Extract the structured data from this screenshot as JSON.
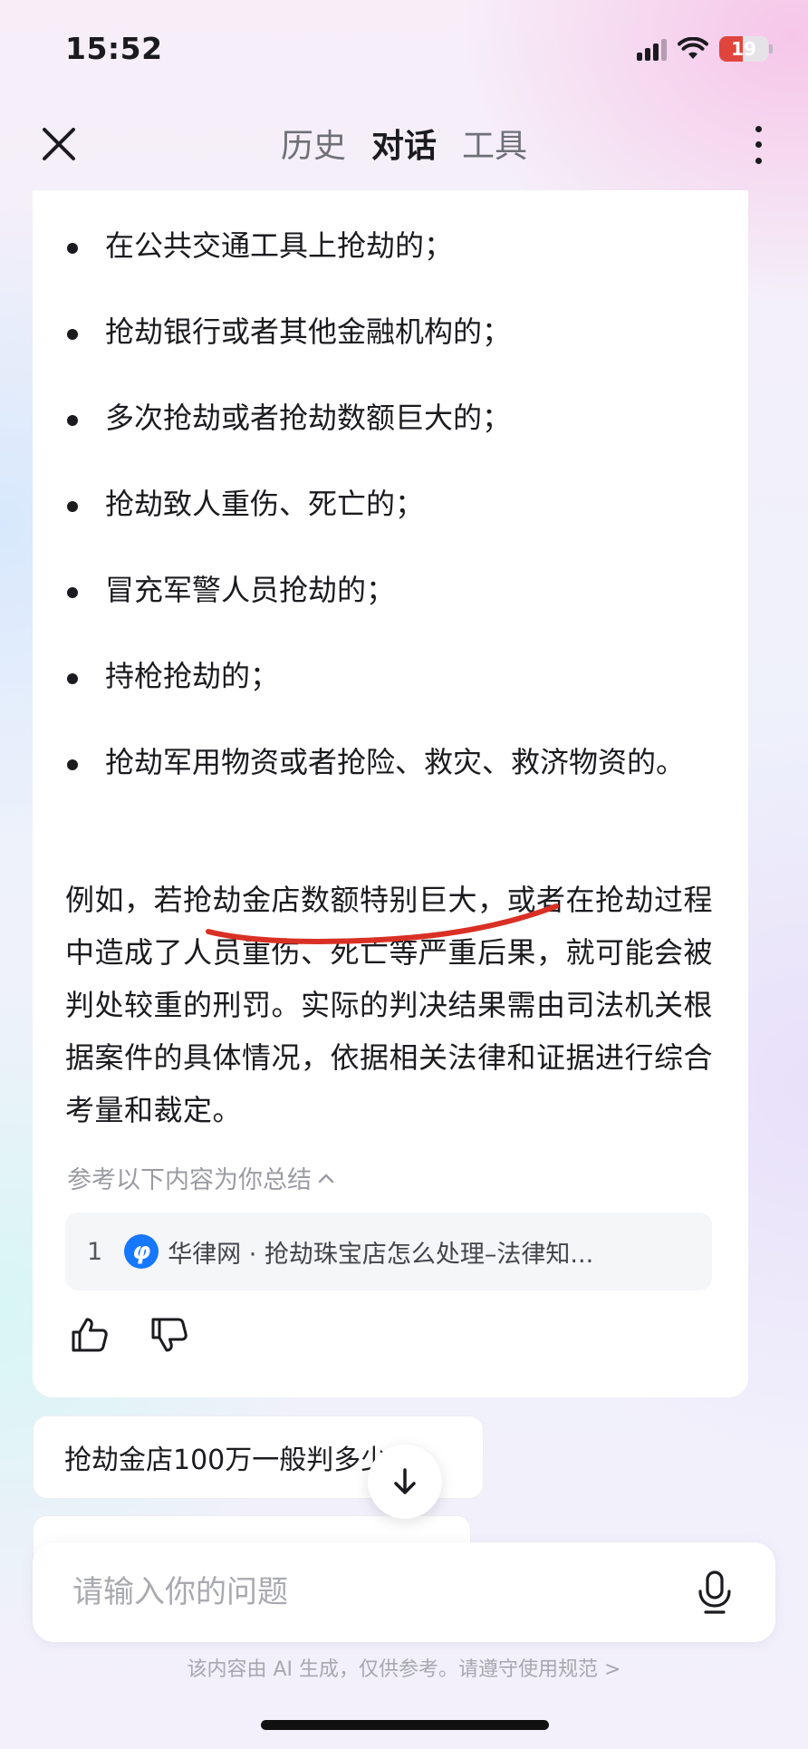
{
  "status_bar": {
    "time": "15:52",
    "battery": "19",
    "battery_percent": 19,
    "battery_color": "#e0453d"
  },
  "header": {
    "close_icon": "close-icon",
    "tabs": [
      {
        "label": "历史",
        "active": false
      },
      {
        "label": "对话",
        "active": true
      },
      {
        "label": "工具",
        "active": false
      }
    ],
    "more_icon": "more-vertical-icon"
  },
  "answer": {
    "bullets": [
      "在公共交通工具上抢劫的；",
      "抢劫银行或者其他金融机构的；",
      "多次抢劫或者抢劫数额巨大的；",
      "抢劫致人重伤、死亡的；",
      "冒充军警人员抢劫的；",
      "持枪抢劫的；",
      "抢劫军用物资或者抢险、救灾、救济物资的。"
    ],
    "paragraph": "例如，若抢劫金店数额特别巨大，或者在抢劫过程中造成了人员重伤、死亡等严重后果，就可能会被判处较重的刑罚。实际的判决结果需由司法机关根据案件的具体情况，依据相关法律和证据进行综合考量和裁定。",
    "underline_color": "#d93025",
    "reference_toggle": "参考以下内容为你总结",
    "reference_toggle_icon": "chevron-up-icon",
    "references": [
      {
        "index": "1",
        "logo_icon": "hualv-logo-icon",
        "text": "华律网 · 抢劫珠宝店怎么处理–法律知..."
      }
    ],
    "feedback": {
      "like_icon": "thumbs-up-icon",
      "dislike_icon": "thumbs-down-icon"
    }
  },
  "suggestions": [
    {
      "label": "抢劫金店100万一般判多少年"
    }
  ],
  "scroll_down_icon": "arrow-down-icon",
  "input": {
    "placeholder": "请输入你的问题",
    "value": "",
    "mic_icon": "microphone-icon"
  },
  "disclaimer": "该内容由 AI 生成，仅供参考。请遵守使用规范 >"
}
